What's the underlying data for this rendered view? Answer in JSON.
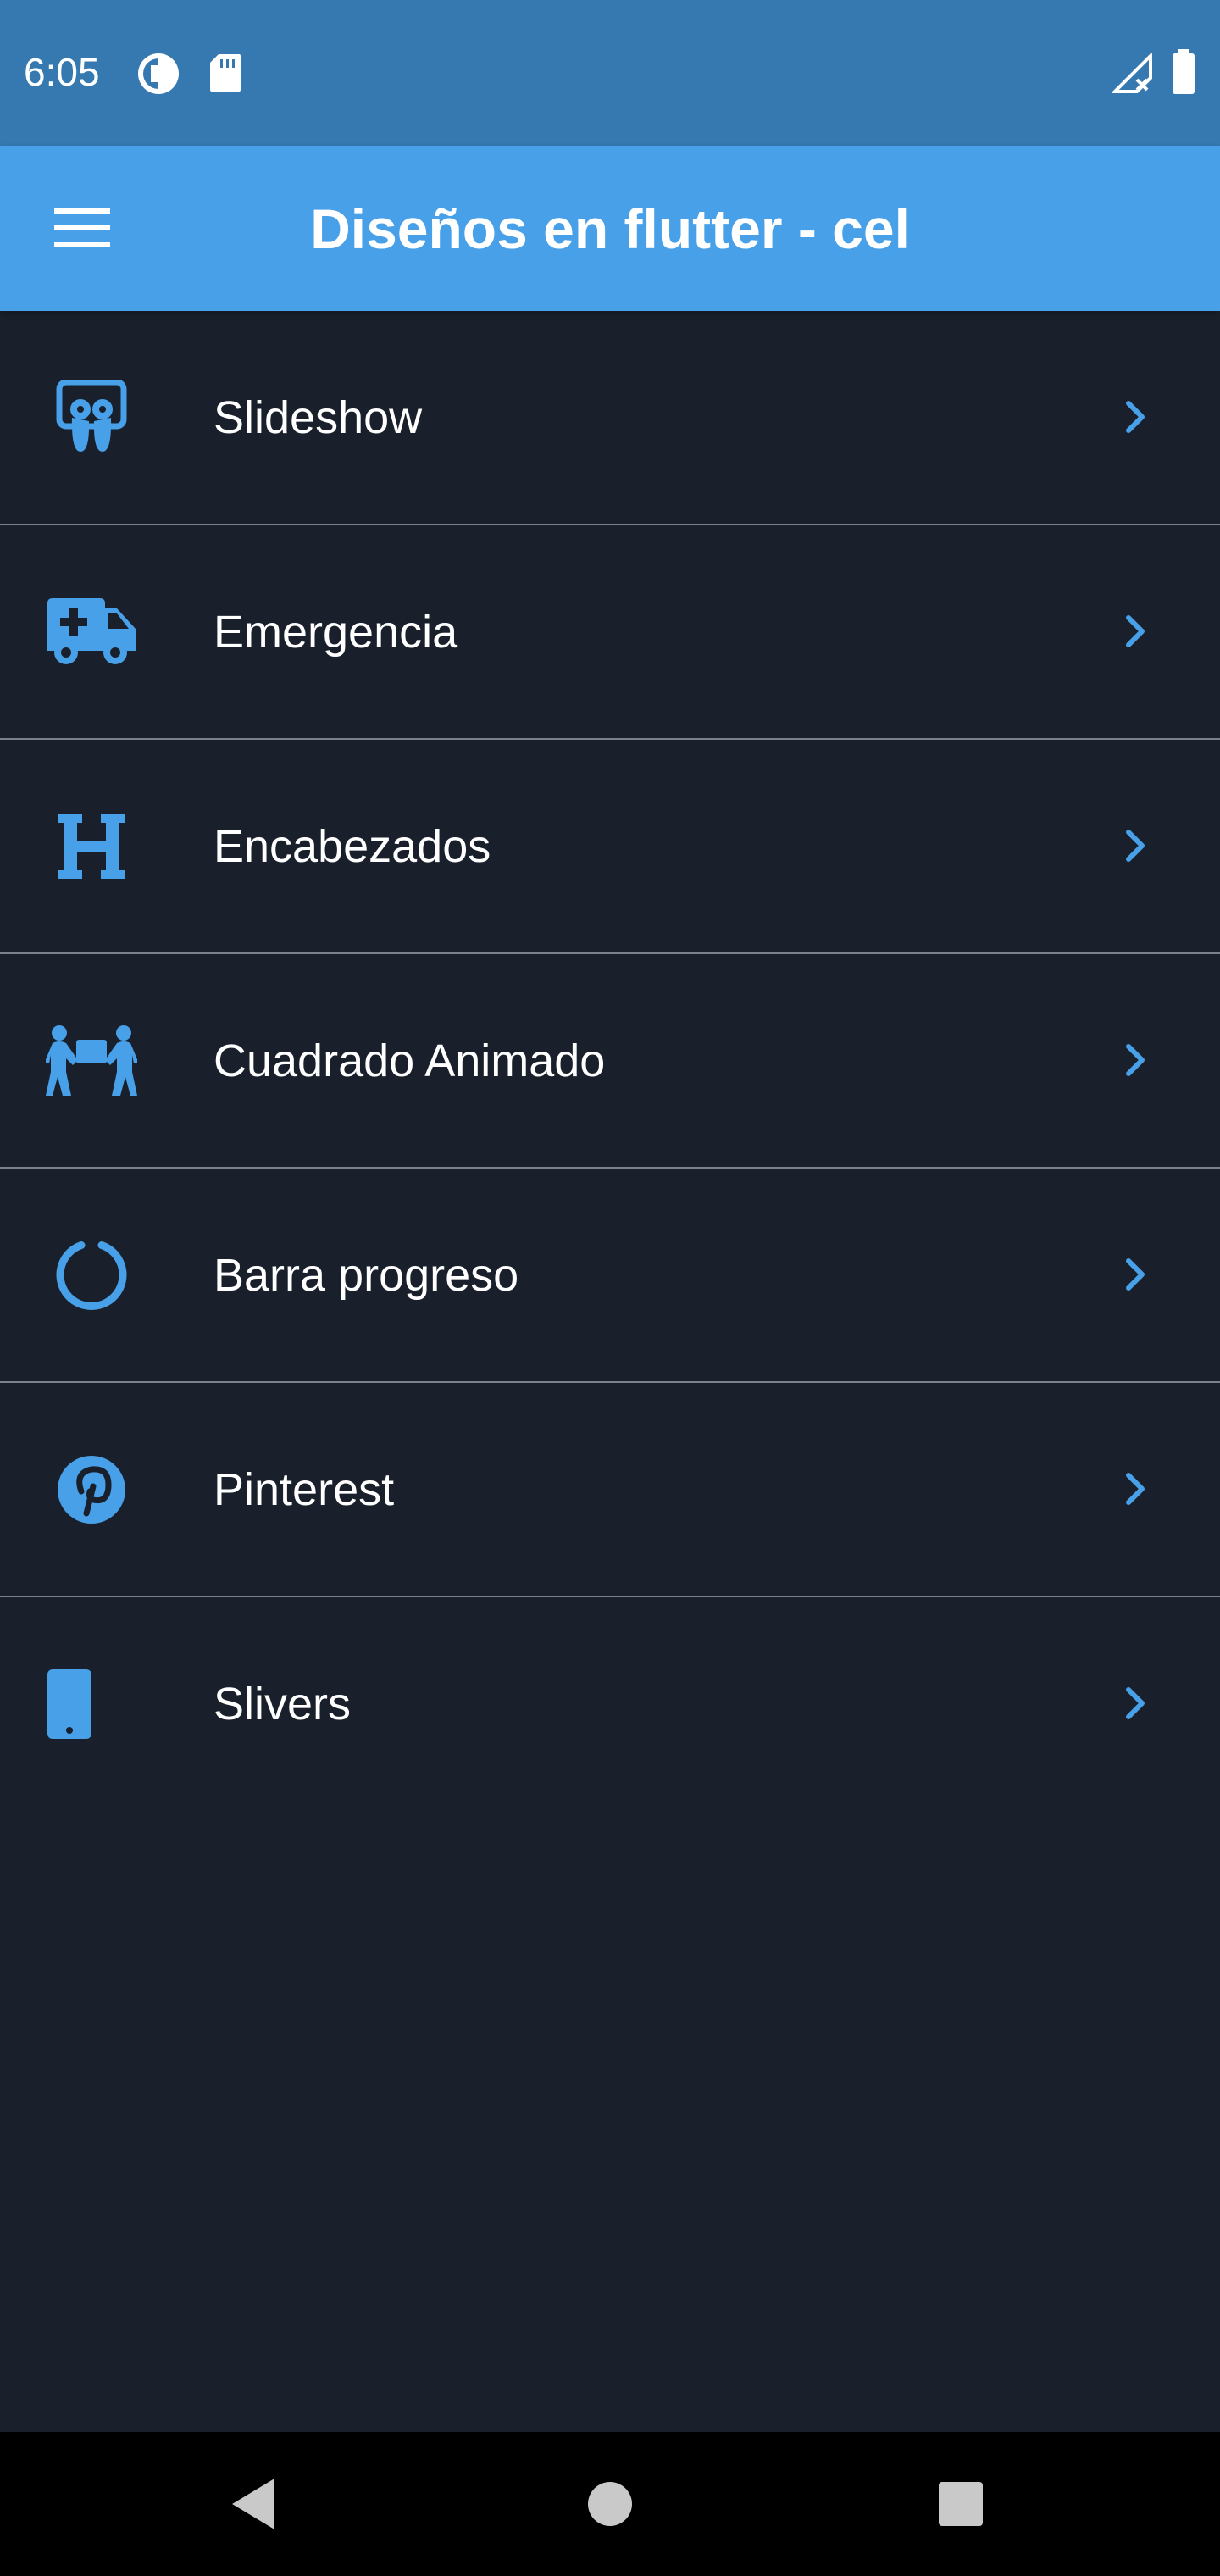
{
  "status_bar": {
    "time": "6:05",
    "icons": [
      "data-saver-icon",
      "sd-card-icon",
      "signal-no-service-icon",
      "battery-icon"
    ]
  },
  "app_bar": {
    "title": "Diseños en flutter - cel",
    "menu_icon": "menu-icon"
  },
  "items": [
    {
      "label": "Slideshow",
      "icon": "slideshare-icon"
    },
    {
      "label": "Emergencia",
      "icon": "ambulance-icon"
    },
    {
      "label": "Encabezados",
      "icon": "heading-icon"
    },
    {
      "label": "Cuadrado Animado",
      "icon": "people-carry-icon"
    },
    {
      "label": "Barra progreso",
      "icon": "circle-notch-icon"
    },
    {
      "label": "Pinterest",
      "icon": "pinterest-icon"
    },
    {
      "label": "Slivers",
      "icon": "mobile-icon"
    }
  ],
  "nav_bar": {
    "buttons": [
      "back-icon",
      "home-icon",
      "recents-icon"
    ]
  },
  "colors": {
    "status_bar": "#3579b0",
    "app_bar": "#47a0e8",
    "background": "#19202b",
    "accent": "#47a0e8",
    "divider": "#7b828c"
  }
}
